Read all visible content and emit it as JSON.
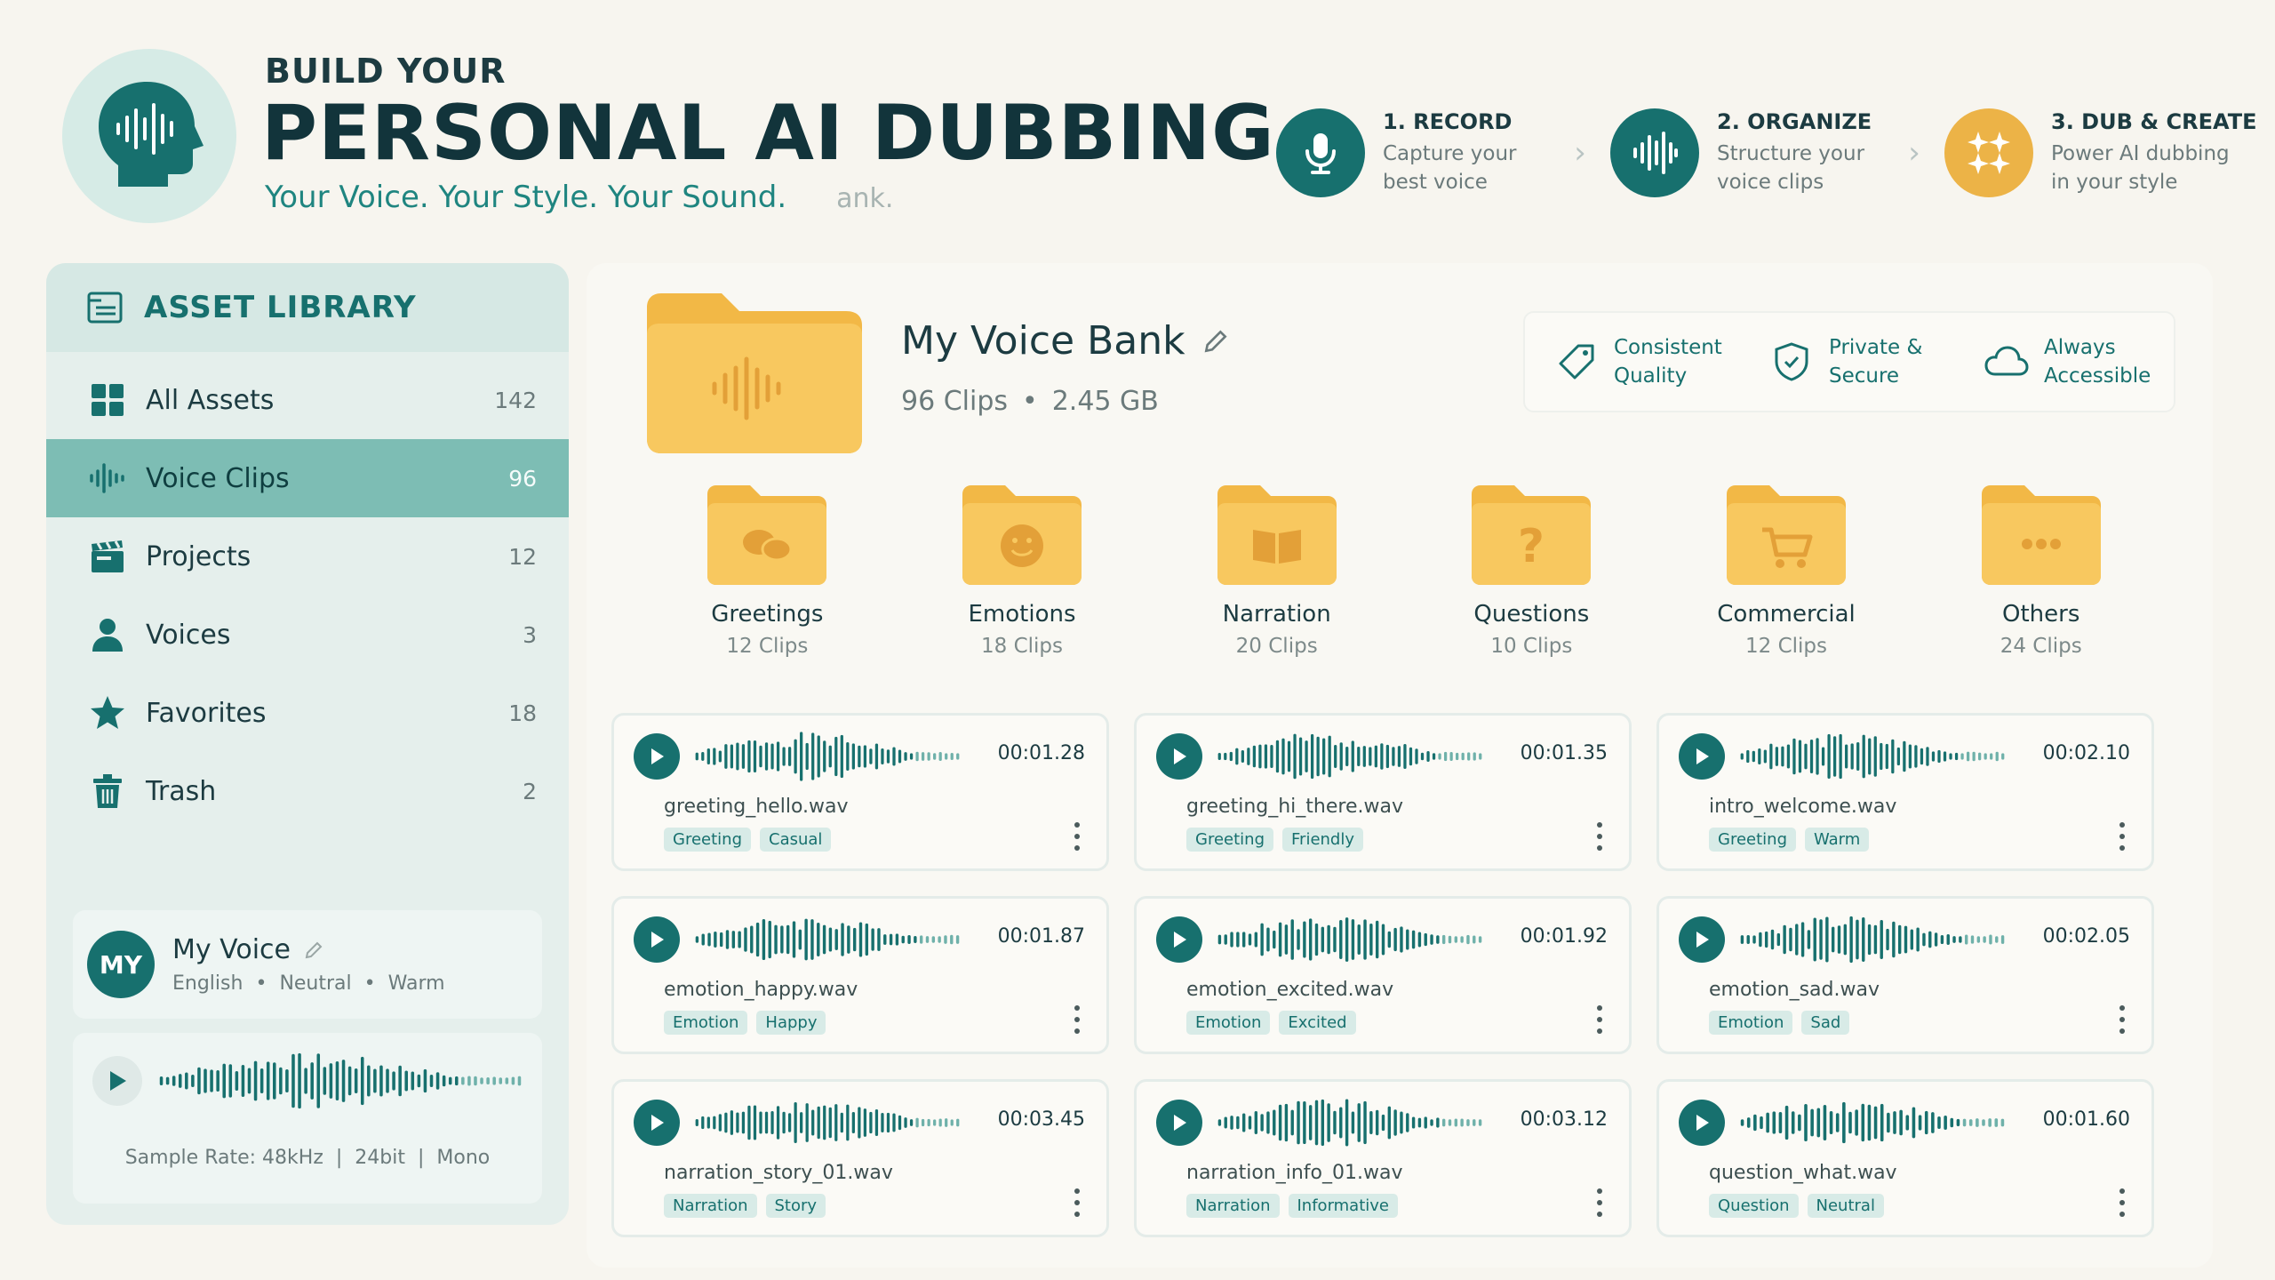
{
  "header": {
    "eyebrow": "BUILD YOUR",
    "title": "PERSONAL AI DUBBING",
    "tagline": "Your Voice. Your Style. Your Sound.",
    "ghost_text": "ank."
  },
  "steps": [
    {
      "title": "1. RECORD",
      "line1": "Capture your",
      "line2": "best voice",
      "icon": "microphone-icon"
    },
    {
      "title": "2. ORGANIZE",
      "line1": "Structure your",
      "line2": "voice clips",
      "icon": "waveform-icon"
    },
    {
      "title": "3. DUB & CREATE",
      "line1": "Power AI dubbing",
      "line2": "in your style",
      "icon": "sparkles-icon"
    }
  ],
  "sidebar": {
    "title": "ASSET LIBRARY",
    "items": [
      {
        "label": "All Assets",
        "count": "142",
        "icon": "grid-icon"
      },
      {
        "label": "Voice Clips",
        "count": "96",
        "icon": "waveform-icon"
      },
      {
        "label": "Projects",
        "count": "12",
        "icon": "clapperboard-icon"
      },
      {
        "label": "Voices",
        "count": "3",
        "icon": "person-icon"
      },
      {
        "label": "Favorites",
        "count": "18",
        "icon": "star-icon"
      },
      {
        "label": "Trash",
        "count": "2",
        "icon": "trash-icon"
      }
    ],
    "voice": {
      "avatar": "MY",
      "name": "My Voice",
      "language": "English",
      "tone": "Neutral",
      "style": "Warm"
    },
    "sample": {
      "rate": "Sample Rate: 48kHz",
      "depth": "24bit",
      "channels": "Mono"
    }
  },
  "bank": {
    "title": "My Voice Bank",
    "clips": "96 Clips",
    "size": "2.45 GB"
  },
  "features": [
    {
      "line1": "Consistent",
      "line2": "Quality",
      "icon": "tag-icon"
    },
    {
      "line1": "Private &",
      "line2": "Secure",
      "icon": "shield-icon"
    },
    {
      "line1": "Always",
      "line2": "Accessible",
      "icon": "cloud-icon"
    }
  ],
  "categories": [
    {
      "name": "Greetings",
      "count": "12 Clips",
      "icon": "chat-bubbles-icon"
    },
    {
      "name": "Emotions",
      "count": "18 Clips",
      "icon": "smiley-icon"
    },
    {
      "name": "Narration",
      "count": "20 Clips",
      "icon": "book-icon"
    },
    {
      "name": "Questions",
      "count": "10 Clips",
      "icon": "question-icon"
    },
    {
      "name": "Commercial",
      "count": "12 Clips",
      "icon": "cart-icon"
    },
    {
      "name": "Others",
      "count": "24 Clips",
      "icon": "dots-icon"
    }
  ],
  "clips": [
    {
      "duration": "00:01.28",
      "name": "greeting_hello.wav",
      "tags": [
        "Greeting",
        "Casual"
      ]
    },
    {
      "duration": "00:01.35",
      "name": "greeting_hi_there.wav",
      "tags": [
        "Greeting",
        "Friendly"
      ]
    },
    {
      "duration": "00:02.10",
      "name": "intro_welcome.wav",
      "tags": [
        "Greeting",
        "Warm"
      ]
    },
    {
      "duration": "00:01.87",
      "name": "emotion_happy.wav",
      "tags": [
        "Emotion",
        "Happy"
      ]
    },
    {
      "duration": "00:01.92",
      "name": "emotion_excited.wav",
      "tags": [
        "Emotion",
        "Excited"
      ]
    },
    {
      "duration": "00:02.05",
      "name": "emotion_sad.wav",
      "tags": [
        "Emotion",
        "Sad"
      ]
    },
    {
      "duration": "00:03.45",
      "name": "narration_story_01.wav",
      "tags": [
        "Narration",
        "Story"
      ]
    },
    {
      "duration": "00:03.12",
      "name": "narration_info_01.wav",
      "tags": [
        "Narration",
        "Informative"
      ]
    },
    {
      "duration": "00:01.60",
      "name": "question_what.wav",
      "tags": [
        "Question",
        "Neutral"
      ]
    }
  ],
  "colors": {
    "teal": "#17706e",
    "gold": "#ecb347",
    "active": "#7dbdb4"
  }
}
